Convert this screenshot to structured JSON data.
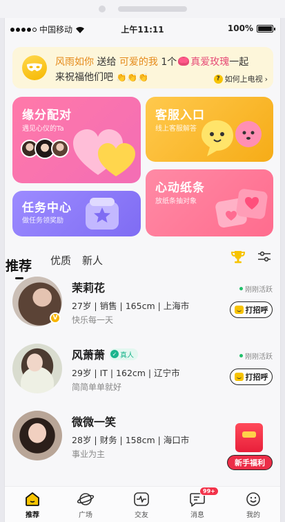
{
  "status_bar": {
    "carrier": "中国移动",
    "time": "上午11:11",
    "battery": "100%"
  },
  "banner": {
    "user_from": "风雨如你",
    "verb": "送给",
    "user_to": "可爱的我",
    "count": "1个",
    "gift": "真爱玫瑰",
    "suffix": "一起",
    "line2": "来祝福他们吧",
    "help_label": "如何上电视",
    "help_icon": "?"
  },
  "features": {
    "match": {
      "title": "缘分配对",
      "subtitle": "遇见心仪的Ta"
    },
    "service": {
      "title": "客服入口",
      "subtitle": "线上客服解答"
    },
    "task": {
      "title": "任务中心",
      "subtitle": "做任务领奖励"
    },
    "note": {
      "title": "心动纸条",
      "subtitle": "放纸条抽对象"
    }
  },
  "tabs": [
    {
      "label": "推荐"
    },
    {
      "label": "优质"
    },
    {
      "label": "新人"
    }
  ],
  "users": [
    {
      "name": "茉莉花",
      "info": "27岁 | 销售 | 165cm | 上海市",
      "motto": "快乐每一天",
      "active": "刚刚活跃",
      "greet": "打招呼",
      "badge": "V"
    },
    {
      "name": "风萧萧",
      "verified": "真人",
      "info": "29岁 | IT | 162cm | 辽宁市",
      "motto": "简简单单就好",
      "active": "刚刚活跃",
      "greet": "打招呼"
    },
    {
      "name": "微微一笑",
      "info": "28岁 | 财务 | 158cm | 海口市",
      "motto": "事业为主",
      "welfare": "新手福利"
    }
  ],
  "tabbar": [
    {
      "label": "推荐",
      "icon": "home-icon"
    },
    {
      "label": "广场",
      "icon": "planet-icon"
    },
    {
      "label": "交友",
      "icon": "pulse-icon"
    },
    {
      "label": "消息",
      "icon": "message-icon",
      "badge": "99+"
    },
    {
      "label": "我的",
      "icon": "smile-icon"
    }
  ],
  "colors": {
    "accent": "#f7c300",
    "pink": "#f36db5",
    "red": "#ec2d47",
    "green": "#1bb58d"
  }
}
